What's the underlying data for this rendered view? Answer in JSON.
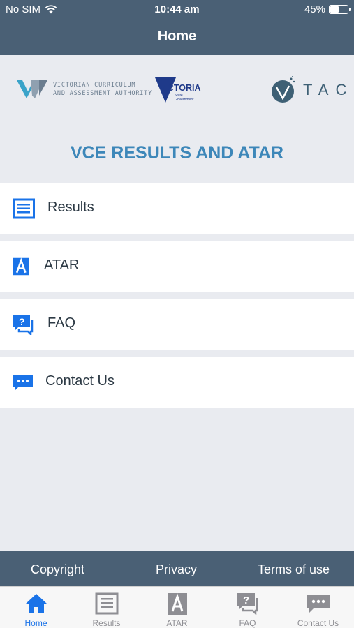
{
  "status_bar": {
    "carrier": "No SIM",
    "time": "10:44 am",
    "battery": "45%"
  },
  "header": {
    "title": "Home"
  },
  "logos": {
    "vcaa_line1": "VICTORIAN CURRICULUM",
    "vcaa_line2": "AND ASSESSMENT AUTHORITY",
    "vic_name": "VICTORIA",
    "vic_sub1": "State",
    "vic_sub2": "Government",
    "tac_letters": "TAC"
  },
  "main": {
    "heading": "VCE RESULTS AND ATAR"
  },
  "menu": [
    {
      "label": "Results",
      "icon": "results-icon"
    },
    {
      "label": "ATAR",
      "icon": "atar-icon"
    },
    {
      "label": "FAQ",
      "icon": "faq-icon"
    },
    {
      "label": "Contact Us",
      "icon": "contact-icon"
    }
  ],
  "footer": {
    "copyright": "Copyright",
    "privacy": "Privacy",
    "terms": "Terms of use"
  },
  "tabs": [
    {
      "label": "Home",
      "active": true
    },
    {
      "label": "Results"
    },
    {
      "label": "ATAR"
    },
    {
      "label": "FAQ"
    },
    {
      "label": "Contact Us"
    }
  ],
  "colors": {
    "brand": "#4a6075",
    "accent": "#1a73e8",
    "heading": "#3d87b9",
    "background": "#e9ebf0"
  }
}
